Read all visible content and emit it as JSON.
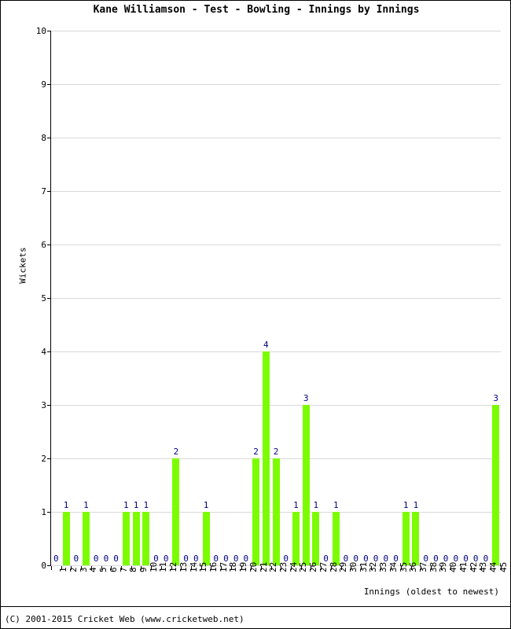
{
  "chart_data": {
    "type": "bar",
    "title": "Kane Williamson - Test - Bowling - Innings by Innings",
    "xlabel": "Innings (oldest to newest)",
    "ylabel": "Wickets",
    "ylim": [
      0,
      10
    ],
    "yticks": [
      0,
      1,
      2,
      3,
      4,
      5,
      6,
      7,
      8,
      9,
      10
    ],
    "grid": true,
    "legend": "none",
    "bar_color": "#7CFC00",
    "value_label_color": "#000080",
    "categories": [
      1,
      2,
      3,
      4,
      5,
      6,
      7,
      8,
      9,
      10,
      11,
      12,
      13,
      14,
      15,
      16,
      17,
      18,
      19,
      20,
      21,
      22,
      23,
      24,
      25,
      26,
      27,
      28,
      29,
      30,
      31,
      32,
      33,
      34,
      35,
      36,
      37,
      38,
      39,
      40,
      41,
      42,
      43,
      44,
      45
    ],
    "values": [
      0,
      1,
      0,
      1,
      0,
      0,
      0,
      1,
      1,
      1,
      0,
      0,
      2,
      0,
      0,
      1,
      0,
      0,
      0,
      0,
      2,
      4,
      2,
      0,
      1,
      3,
      1,
      0,
      1,
      0,
      0,
      0,
      0,
      0,
      0,
      1,
      1,
      0,
      0,
      0,
      0,
      0,
      0,
      0,
      3
    ]
  },
  "footer": {
    "copyright": "(C) 2001-2015 Cricket Web (www.cricketweb.net)"
  }
}
